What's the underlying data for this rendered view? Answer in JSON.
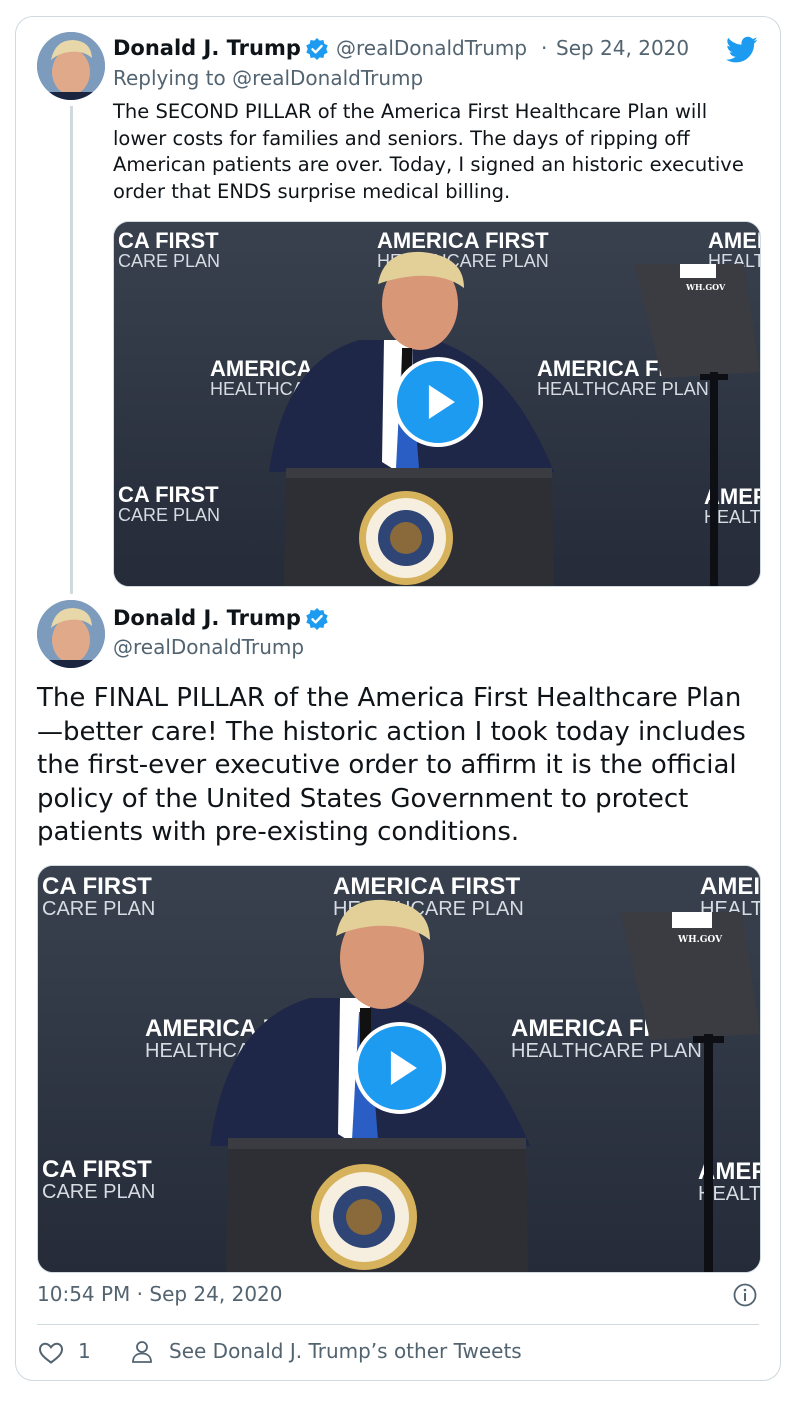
{
  "tweet_parent": {
    "author_name": "Donald J. Trump",
    "handle": "@realDonaldTrump",
    "separator": "·",
    "date": "Sep 24, 2020",
    "replying_to": "Replying to @realDonaldTrump",
    "text": "The SECOND PILLAR of the America First Healthcare Plan will lower costs for families and seniors. The days of ripping off American patients are over. Today, I signed an historic executive order that ENDS surprise medical billing.",
    "video": {
      "banner_center_line1": "AMERICA FIRST",
      "banner_center_line2": "HEALTHCARE PLAN",
      "banner_left_line1": "CA FIRST",
      "banner_left_line2": "CARE PLAN",
      "banner_mid_left_line1": "AMERICA",
      "banner_mid_left_line2": "HEALTHCA",
      "banner_mid_right_line1": "AMERICA FIRST",
      "banner_mid_right_line2": "HEALTHCARE PLAN",
      "banner_right_line1": "AMEI",
      "banner_right_line2": "HEALT",
      "banner_bottom_right_line1": "AMEF",
      "banner_bottom_right_line2": "HEALT",
      "prompter_label": "WH.GOV"
    }
  },
  "tweet_main": {
    "author_name": "Donald J. Trump",
    "handle": "@realDonaldTrump",
    "text": "The FINAL PILLAR of the America First Healthcare Plan—better care! The historic action I took today includes the first-ever executive order to affirm it is the official policy of the United States Government to protect patients with pre-existing conditions.",
    "video": {
      "banner_center_line1": "AMERICA FIRST",
      "banner_center_line2": "HEALTHCARE PLAN",
      "banner_left_line1": "CA FIRST",
      "banner_left_line2": "CARE PLAN",
      "banner_mid_left_line1": "AMERICA F",
      "banner_mid_left_line2": "HEALTHCAR",
      "banner_mid_right_line1": "AMERICA FIRST",
      "banner_mid_right_line2": "HEALTHCARE PLAN",
      "banner_right_line1": "AMEI",
      "banner_right_line2": "HEALT",
      "banner_bottom_right_line1": "AMEF",
      "banner_bottom_right_line2": "HEALT",
      "prompter_label": "WH.GOV"
    },
    "timestamp": "10:54 PM · Sep 24, 2020",
    "like_count": "1",
    "other_tweets_link": "See Donald J. Trump’s other Tweets"
  },
  "icons": {
    "verified": "verified-badge-icon",
    "twitter": "twitter-bird-icon",
    "info": "info-icon",
    "like": "heart-icon",
    "profile": "person-icon",
    "play": "play-icon"
  },
  "colors": {
    "accent": "#1d9bf0",
    "text": "#0f1419",
    "secondary": "#536471",
    "border": "#cfd9de",
    "video_backdrop": "#2a3040"
  }
}
